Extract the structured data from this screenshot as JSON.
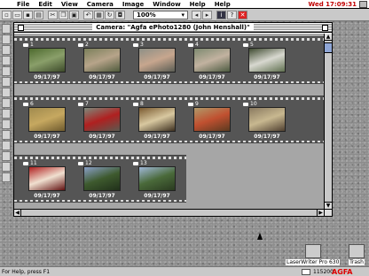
{
  "menubar": {
    "items": [
      "File",
      "Edit",
      "View",
      "Camera",
      "Image",
      "Window",
      "Help",
      "Help"
    ],
    "clock": "Wed 17:09:31"
  },
  "toolbar": {
    "zoom_value": "100%"
  },
  "window": {
    "title": "Camera: \"Agfa ePhoto1280 (John Henshall)\""
  },
  "photos": [
    {
      "num": "1",
      "date": "09/17/97",
      "colors": [
        "#4d6a2e",
        "#8a9f6a",
        "#3d4a2a"
      ]
    },
    {
      "num": "2",
      "date": "09/17/97",
      "colors": [
        "#7a7f5a",
        "#b7a48a",
        "#4e5a3c"
      ]
    },
    {
      "num": "3",
      "date": "09/17/97",
      "colors": [
        "#8d8f86",
        "#c7a68e",
        "#5a5d54"
      ]
    },
    {
      "num": "4",
      "date": "09/17/97",
      "colors": [
        "#7d8a70",
        "#c2b2a0",
        "#4c5a40"
      ]
    },
    {
      "num": "5",
      "date": "09/17/97",
      "colors": [
        "#3e4a30",
        "#d8d8d0",
        "#607050"
      ]
    },
    {
      "num": "6",
      "date": "09/17/97",
      "colors": [
        "#a08a4e",
        "#c6a860",
        "#6e5a2e"
      ]
    },
    {
      "num": "7",
      "date": "09/17/97",
      "colors": [
        "#7c8a7c",
        "#b02020",
        "#5a5a50"
      ]
    },
    {
      "num": "8",
      "date": "09/17/97",
      "colors": [
        "#7a5a30",
        "#d8c8a0",
        "#3e3020"
      ]
    },
    {
      "num": "9",
      "date": "09/17/97",
      "colors": [
        "#b09a6a",
        "#c05030",
        "#5a3a20"
      ]
    },
    {
      "num": "10",
      "date": "09/17/97",
      "colors": [
        "#8a7a60",
        "#c8b890",
        "#504030"
      ]
    },
    {
      "num": "11",
      "date": "09/17/97",
      "colors": [
        "#b02020",
        "#f0e0d0",
        "#601010"
      ]
    },
    {
      "num": "12",
      "date": "09/17/97",
      "colors": [
        "#8aa0c8",
        "#3e5a2e",
        "#20301a"
      ]
    },
    {
      "num": "13",
      "date": "09/17/97",
      "colors": [
        "#a0b8d8",
        "#4a6a3a",
        "#2a3a20"
      ]
    }
  ],
  "desktop": {
    "printer_label": "LaserWriter Pro 630",
    "trash_label": "Trash"
  },
  "statusbar": {
    "help": "For Help, press F1",
    "resolution": "115200",
    "logo": "AGFA"
  }
}
